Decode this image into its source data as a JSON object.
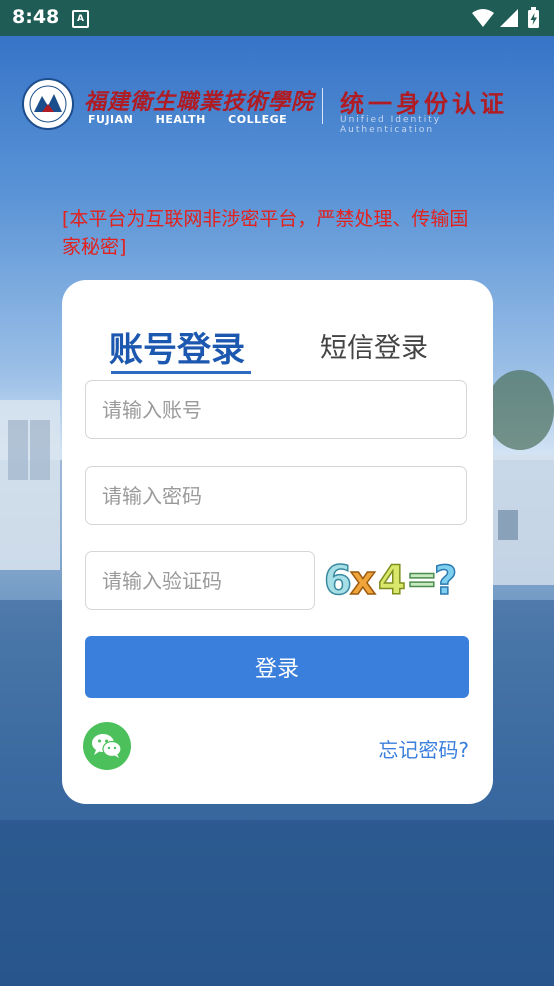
{
  "status_bar": {
    "time": "8:48",
    "notification_icon_label": "A"
  },
  "header": {
    "college_name_cn": "福建衛生職業技術學院",
    "college_name_en": "FUJIAN  HEALTH  COLLEGE",
    "auth_title": "统一身份认证",
    "auth_subtitle": "Unified Identity Authentication"
  },
  "notice": "[本平台为互联网非涉密平台，严禁处理、传输国家秘密]",
  "login_card": {
    "tabs": [
      {
        "label": "账号登录",
        "active": true
      },
      {
        "label": "短信登录",
        "active": false
      }
    ],
    "account_placeholder": "请输入账号",
    "password_placeholder": "请输入密码",
    "captcha_placeholder": "请输入验证码",
    "captcha_text": "6x4=?",
    "login_button": "登录",
    "forgot_password": "忘记密码?"
  },
  "colors": {
    "status_bar": "#1e5c55",
    "brand_red": "#b01c24",
    "primary_blue": "#3a7fdc",
    "tab_active": "#1d58b0",
    "notice_red": "#e3211d",
    "wechat_green": "#4cc05a"
  },
  "icons": [
    "wifi-icon",
    "signal-icon",
    "battery-icon",
    "college-logo-icon",
    "wechat-icon"
  ]
}
